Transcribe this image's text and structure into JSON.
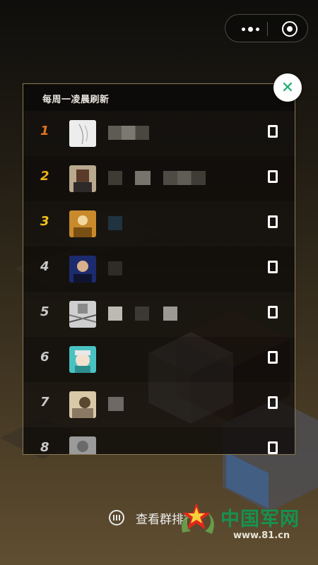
{
  "panel": {
    "title": "每周一凌晨刷新",
    "close_symbol": "✕"
  },
  "ranking": [
    {
      "rank": "1",
      "rank_color": "#e0731f",
      "avatar": "avatar-1",
      "score": "0"
    },
    {
      "rank": "2",
      "rank_color": "#f0b31a",
      "avatar": "avatar-2",
      "score": "0"
    },
    {
      "rank": "3",
      "rank_color": "#f0c21c",
      "avatar": "avatar-3",
      "score": "0"
    },
    {
      "rank": "4",
      "rank_color": "#c9c9c9",
      "avatar": "avatar-4",
      "score": "0"
    },
    {
      "rank": "5",
      "rank_color": "#c9c9c9",
      "avatar": "avatar-5",
      "score": "0"
    },
    {
      "rank": "6",
      "rank_color": "#c9c9c9",
      "avatar": "avatar-6",
      "score": "0"
    },
    {
      "rank": "7",
      "rank_color": "#c9c9c9",
      "avatar": "avatar-7",
      "score": "0"
    },
    {
      "rank": "8",
      "rank_color": "#c9c9c9",
      "avatar": "avatar-8",
      "score": "0"
    }
  ],
  "footer": {
    "group_rank_label": "查看群排行"
  },
  "watermark": {
    "name": "中国军网",
    "url": "www.81.cn"
  },
  "colors": {
    "accent_green": "#1aad6e",
    "panel_border": "#8a7a55"
  },
  "icons": {
    "capsule_more": "more-dots-icon",
    "capsule_close": "target-circle-icon",
    "close": "close-icon",
    "group_rank": "bar-chart-circle-icon"
  }
}
